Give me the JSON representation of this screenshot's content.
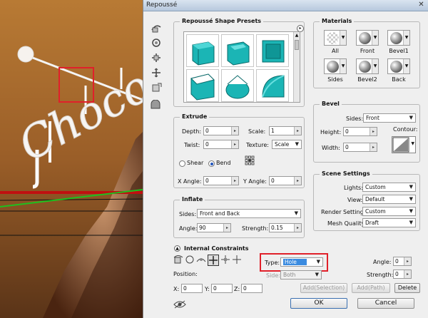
{
  "dialog": {
    "title": "Repoussé",
    "close_glyph": "✕"
  },
  "background": {
    "decorative_text": "Choco"
  },
  "presets": {
    "legend": "Repoussé Shape Presets",
    "items": [
      {
        "icon": "extrude-preset-icon"
      },
      {
        "icon": "bevel-preset-icon"
      },
      {
        "icon": "inflate-preset-icon"
      },
      {
        "icon": "pillow-preset-icon"
      },
      {
        "icon": "round-preset-icon"
      },
      {
        "icon": "twist-preset-icon"
      }
    ]
  },
  "materials": {
    "legend": "Materials",
    "swatches": [
      {
        "label": "All"
      },
      {
        "label": "Front"
      },
      {
        "label": "Bevel1"
      },
      {
        "label": "Sides"
      },
      {
        "label": "Bevel2"
      },
      {
        "label": "Back"
      }
    ]
  },
  "extrude": {
    "legend": "Extrude",
    "depth_label": "Depth:",
    "depth_value": "0",
    "scale_label": "Scale:",
    "scale_value": "1",
    "twist_label": "Twist:",
    "twist_value": "0",
    "texture_label": "Texture:",
    "texture_value": "Scale",
    "shear_label": "Shear",
    "bend_label": "Bend",
    "xangle_label": "X Angle:",
    "xangle_value": "0",
    "yangle_label": "Y Angle:",
    "yangle_value": "0"
  },
  "bevel": {
    "legend": "Bevel",
    "sides_label": "Sides:",
    "sides_value": "Front",
    "height_label": "Height:",
    "height_value": "0",
    "contour_label": "Contour:",
    "width_label": "Width:",
    "width_value": "0"
  },
  "inflate": {
    "legend": "Inflate",
    "sides_label": "Sides:",
    "sides_value": "Front and Back",
    "angle_label": "Angle:",
    "angle_value": "90",
    "strength_label": "Strength:",
    "strength_value": "0.15"
  },
  "scene": {
    "legend": "Scene Settings",
    "lights_label": "Lights:",
    "lights_value": "Custom",
    "view_label": "View:",
    "view_value": "Default",
    "render_label": "Render Settings:",
    "render_value": "Custom",
    "mesh_label": "Mesh Quality:",
    "mesh_value": "Draft"
  },
  "constraints": {
    "legend": "Internal Constraints",
    "type_label": "Type:",
    "type_value": "Hole",
    "side_label": "Side:",
    "side_value": "Both",
    "position_label": "Position:",
    "angle_label": "Angle:",
    "angle_value": "0",
    "strength_label": "Strength:",
    "strength_value": "0",
    "x_label": "X:",
    "x_value": "0",
    "y_label": "Y:",
    "y_value": "0",
    "z_label": "Z:",
    "z_value": "0",
    "add_selection_label": "Add(Selection)",
    "add_path_label": "Add(Path)",
    "delete_label": "Delete"
  },
  "footer": {
    "ok_label": "OK",
    "cancel_label": "Cancel"
  },
  "colors": {
    "highlight_box": "#e0202a",
    "type_select_bg": "#3b8be0",
    "preset_cyan": "#1bb5b5"
  }
}
